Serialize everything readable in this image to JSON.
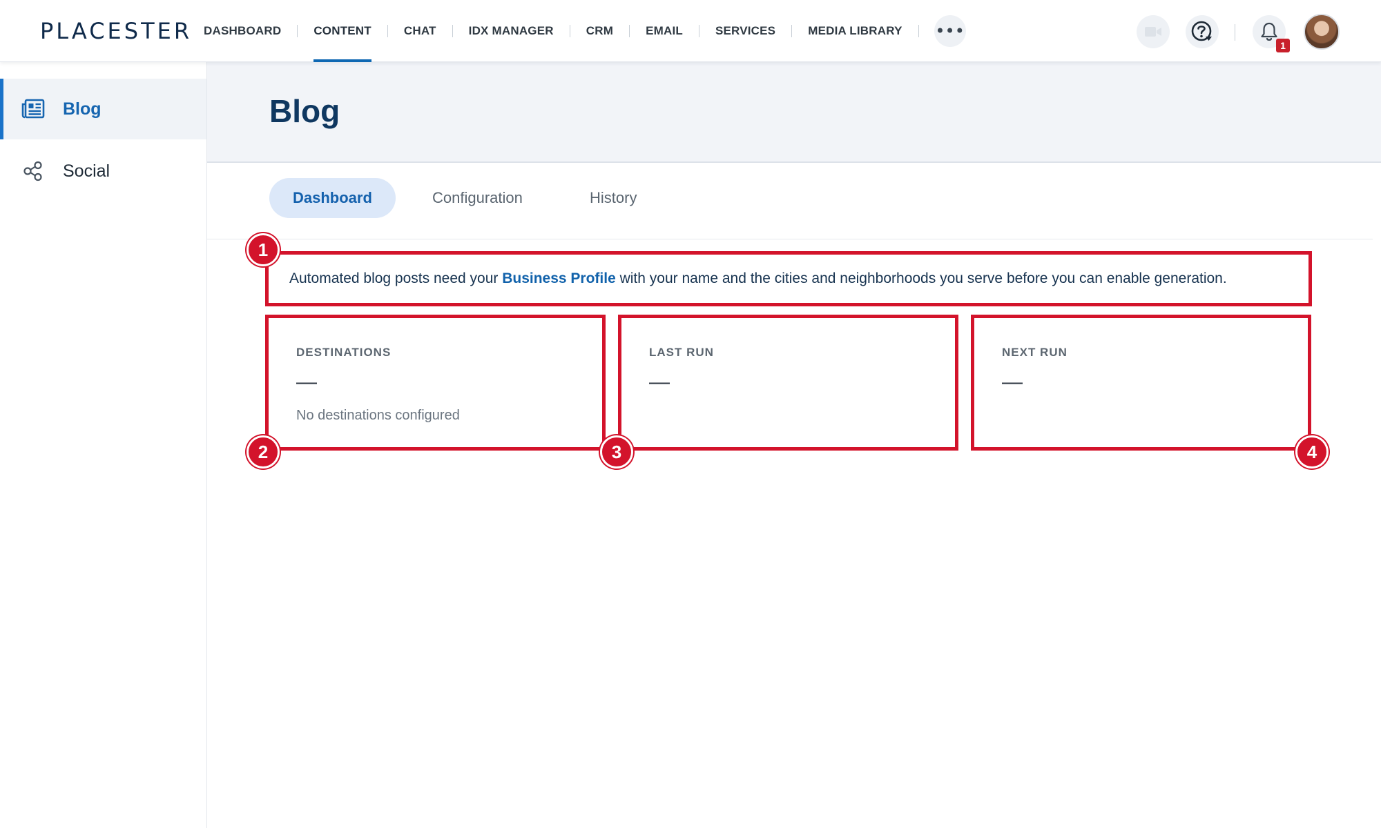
{
  "app": {
    "logo": "PLACESTER"
  },
  "nav": {
    "items": [
      "DASHBOARD",
      "CONTENT",
      "CHAT",
      "IDX MANAGER",
      "CRM",
      "EMAIL",
      "SERVICES",
      "MEDIA LIBRARY"
    ],
    "active": "CONTENT",
    "more_label": "•••",
    "notification_count": "1"
  },
  "sidebar": {
    "items": [
      {
        "label": "Blog",
        "icon": "newspaper-icon",
        "active": true
      },
      {
        "label": "Social",
        "icon": "share-icon",
        "active": false
      }
    ]
  },
  "page": {
    "title": "Blog"
  },
  "tabs": {
    "items": [
      "Dashboard",
      "Configuration",
      "History"
    ],
    "active": "Dashboard"
  },
  "notice": {
    "before": "Automated blog posts need your ",
    "link": "Business Profile",
    "after": " with your name and the cities and neighborhoods you serve before you can enable generation."
  },
  "cards": [
    {
      "title": "DESTINATIONS",
      "value": "—",
      "subtitle": "No destinations configured"
    },
    {
      "title": "LAST RUN",
      "value": "—"
    },
    {
      "title": "NEXT RUN",
      "value": "—"
    }
  ],
  "markers": [
    "1",
    "2",
    "3",
    "4"
  ],
  "colors": {
    "accent": "#0f68b3",
    "annotation": "#d3132b",
    "header_bg": "#f2f4f8",
    "title": "#0f3760"
  }
}
